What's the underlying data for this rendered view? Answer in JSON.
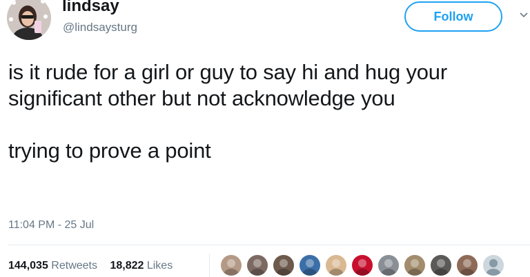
{
  "user": {
    "display_name": "lindsay",
    "handle": "@lindsaysturg",
    "avatar_icon": "profile-photo-icon"
  },
  "follow_label": "Follow",
  "tweet": {
    "paragraph_1": "is it rude for a girl or guy to say hi and hug your significant other but not acknowledge you",
    "paragraph_2": "trying to prove a point",
    "timestamp": "11:04 PM - 25 Jul"
  },
  "stats": {
    "retweets_count": "144,035",
    "retweets_label": "Retweets",
    "likes_count": "18,822",
    "likes_label": "Likes"
  },
  "likers": [
    {
      "icon": "liker-avatar-icon",
      "color": "#b49a86"
    },
    {
      "icon": "liker-avatar-icon",
      "color": "#7c6a62"
    },
    {
      "icon": "liker-avatar-icon",
      "color": "#6d5a4c"
    },
    {
      "icon": "liker-avatar-icon",
      "color": "#3b6fa8"
    },
    {
      "icon": "liker-avatar-icon",
      "color": "#d9b892"
    },
    {
      "icon": "liker-avatar-icon",
      "color": "#c8102e"
    },
    {
      "icon": "liker-avatar-icon",
      "color": "#8a8f96"
    },
    {
      "icon": "liker-avatar-icon",
      "color": "#a38c6e"
    },
    {
      "icon": "liker-avatar-icon",
      "color": "#5c5a58"
    },
    {
      "icon": "liker-avatar-icon",
      "color": "#8e6a58"
    },
    {
      "icon": "default-avatar-icon",
      "color": "#ccd6dd"
    }
  ],
  "colors": {
    "accent": "#1da1f2",
    "text": "#14171a",
    "muted": "#657786",
    "divider": "#e6ecf0"
  }
}
